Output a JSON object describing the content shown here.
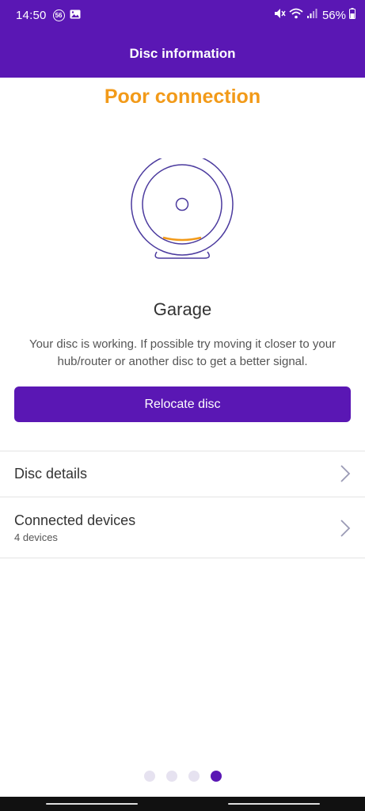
{
  "status_bar": {
    "time": "14:50",
    "badge": "56",
    "battery": "56%"
  },
  "app_bar": {
    "title": "Disc information"
  },
  "status": {
    "heading": "Poor connection",
    "heading_color": "#f29a19"
  },
  "disc": {
    "location": "Garage",
    "message": "Your disc is working. If possible try moving it closer to your hub/router or another disc to get a better signal."
  },
  "actions": {
    "relocate_label": "Relocate disc"
  },
  "list": [
    {
      "label": "Disc details",
      "sub": ""
    },
    {
      "label": "Connected devices",
      "sub": "4 devices"
    }
  ],
  "pager": {
    "total": 4,
    "active_index": 3
  },
  "colors": {
    "brand": "#5a17b4",
    "warning": "#f29a19"
  }
}
